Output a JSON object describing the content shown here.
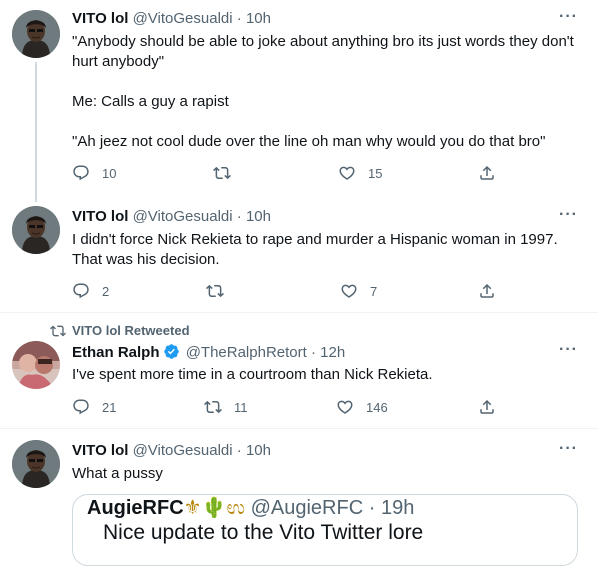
{
  "tweets": [
    {
      "name": "VITO lol",
      "handle": "@VitoGesualdi",
      "dot": "·",
      "time": "10h",
      "text": "\"Anybody should be able to joke about anything bro its just words they don't hurt anybody\"\n\nMe: Calls a guy a rapist\n\n\"Ah jeez not cool dude over the line oh man why would you do that bro\"",
      "replies": "10",
      "retweets": "",
      "likes": "15"
    },
    {
      "name": "VITO lol",
      "handle": "@VitoGesualdi",
      "dot": "·",
      "time": "10h",
      "text": "I didn't force Nick Rekieta to rape and murder a Hispanic woman in 1997. That was his decision.",
      "replies": "2",
      "retweets": "",
      "likes": "7"
    },
    {
      "retweeted_by": "VITO lol Retweeted",
      "name": "Ethan Ralph",
      "handle": "@TheRalphRetort",
      "dot": "·",
      "time": "12h",
      "text": "I've spent more time in a courtroom than Nick Rekieta.",
      "replies": "21",
      "retweets": "11",
      "likes": "146"
    },
    {
      "name": "VITO lol",
      "handle": "@VitoGesualdi",
      "dot": "·",
      "time": "10h",
      "text": "What a pussy"
    }
  ],
  "quote": {
    "name": "AugieRFC",
    "name_emoji": "⚜🌵ಉ",
    "handle": "@AugieRFC",
    "dot": "·",
    "time": "19h",
    "text": "Nice update to the Vito Twitter lore"
  },
  "more_label": "···",
  "icons": {
    "reply": "reply-icon",
    "retweet": "retweet-icon",
    "like": "heart-icon",
    "share": "share-icon",
    "verified": "verified-badge-icon"
  },
  "colors": {
    "text": "#0f1419",
    "secondary": "#536471",
    "verified": "#1d9bf0",
    "divider": "#eff3f4",
    "thread_line": "#cfd9de"
  }
}
